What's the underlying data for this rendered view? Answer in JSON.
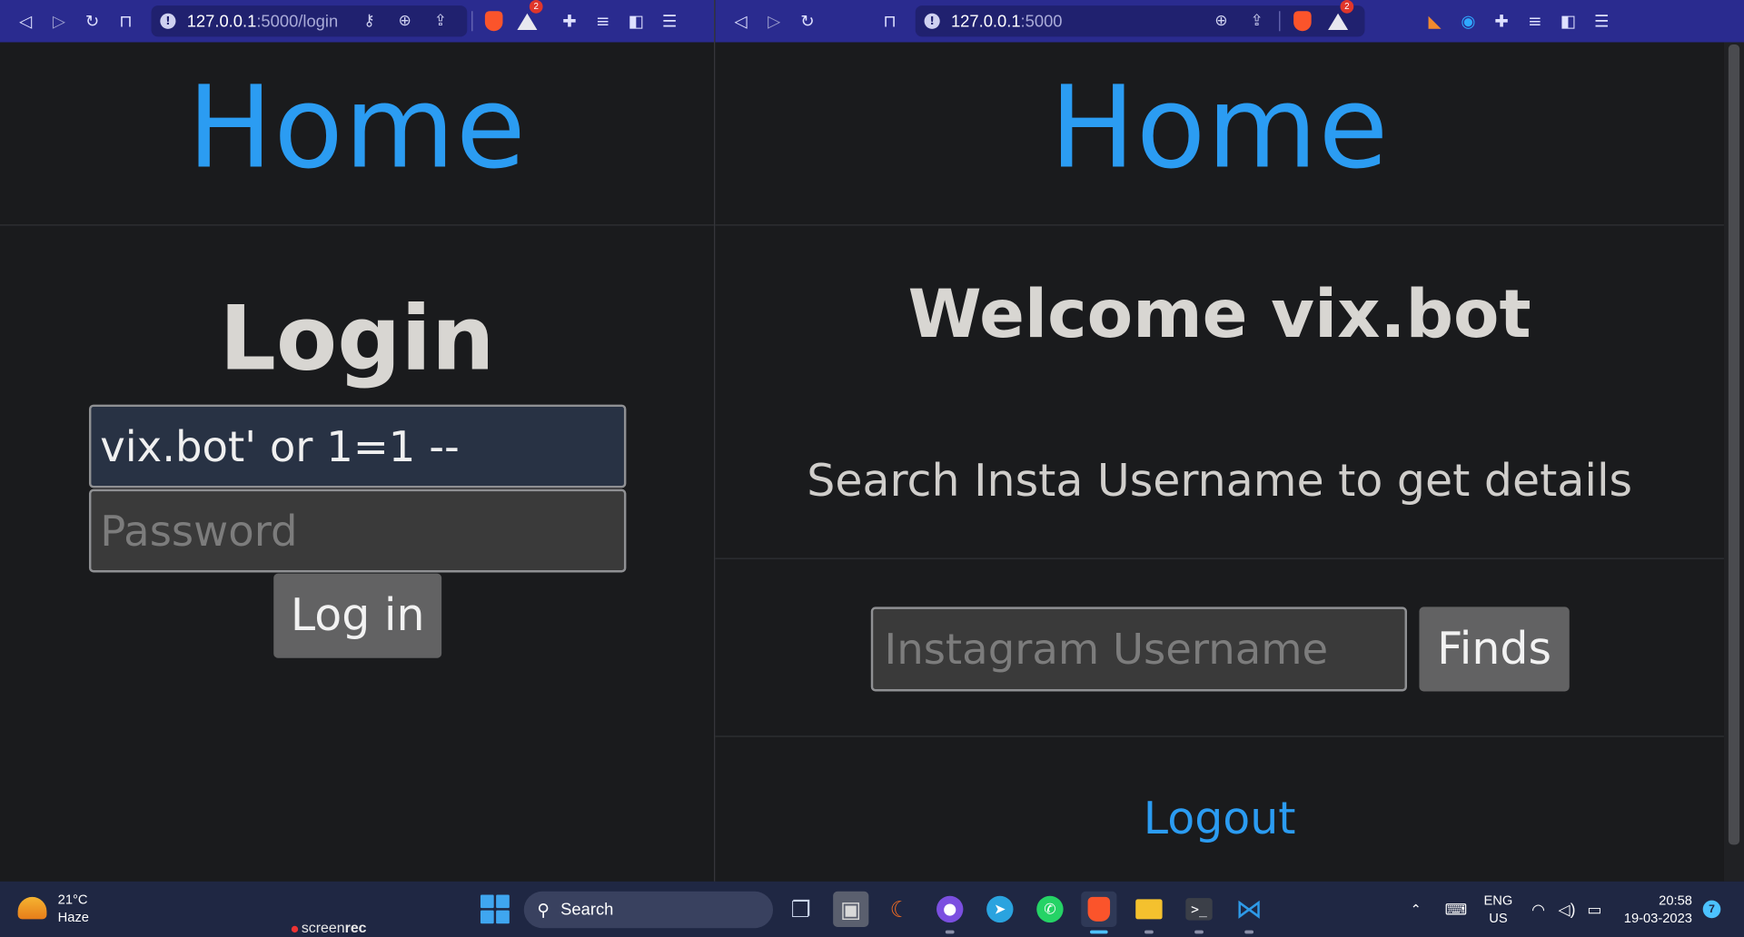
{
  "left_window": {
    "url_host": "127.0.0.1",
    "url_path": ":5000/login",
    "page": {
      "home_link": "Home",
      "login_title": "Login",
      "username_value": "vix.bot' or 1=1 --",
      "password_placeholder": "Password",
      "login_button": "Log in"
    },
    "shields_badge": "2"
  },
  "right_window": {
    "url_host": "127.0.0.1",
    "url_path": ":5000",
    "page": {
      "home_link": "Home",
      "welcome": "Welcome vix.bot",
      "subtitle": "Search Insta Username to get details",
      "insta_placeholder": "Instagram Username",
      "finds_button": "Finds",
      "logout_link": "Logout"
    },
    "shields_badge": "2"
  },
  "taskbar": {
    "weather_temp": "21°C",
    "weather_desc": "Haze",
    "screenrec_label_a": "screen",
    "screenrec_label_b": "rec",
    "search_label": "Search",
    "language_top": "ENG",
    "language_bottom": "US",
    "time": "20:58",
    "date": "19-03-2023",
    "notification_count": "7",
    "apps": [
      "task-view",
      "photos",
      "app-orange",
      "github-desktop",
      "telegram",
      "whatsapp",
      "brave",
      "file-explorer",
      "terminal",
      "vscode"
    ]
  },
  "colors": {
    "toolbar": "#2a2b8f",
    "page_bg": "#1a1b1d",
    "link_blue": "#2b9cf2",
    "input_dark": "#3a3a3a",
    "button_gray": "#626263",
    "taskbar": "#1f2743"
  }
}
